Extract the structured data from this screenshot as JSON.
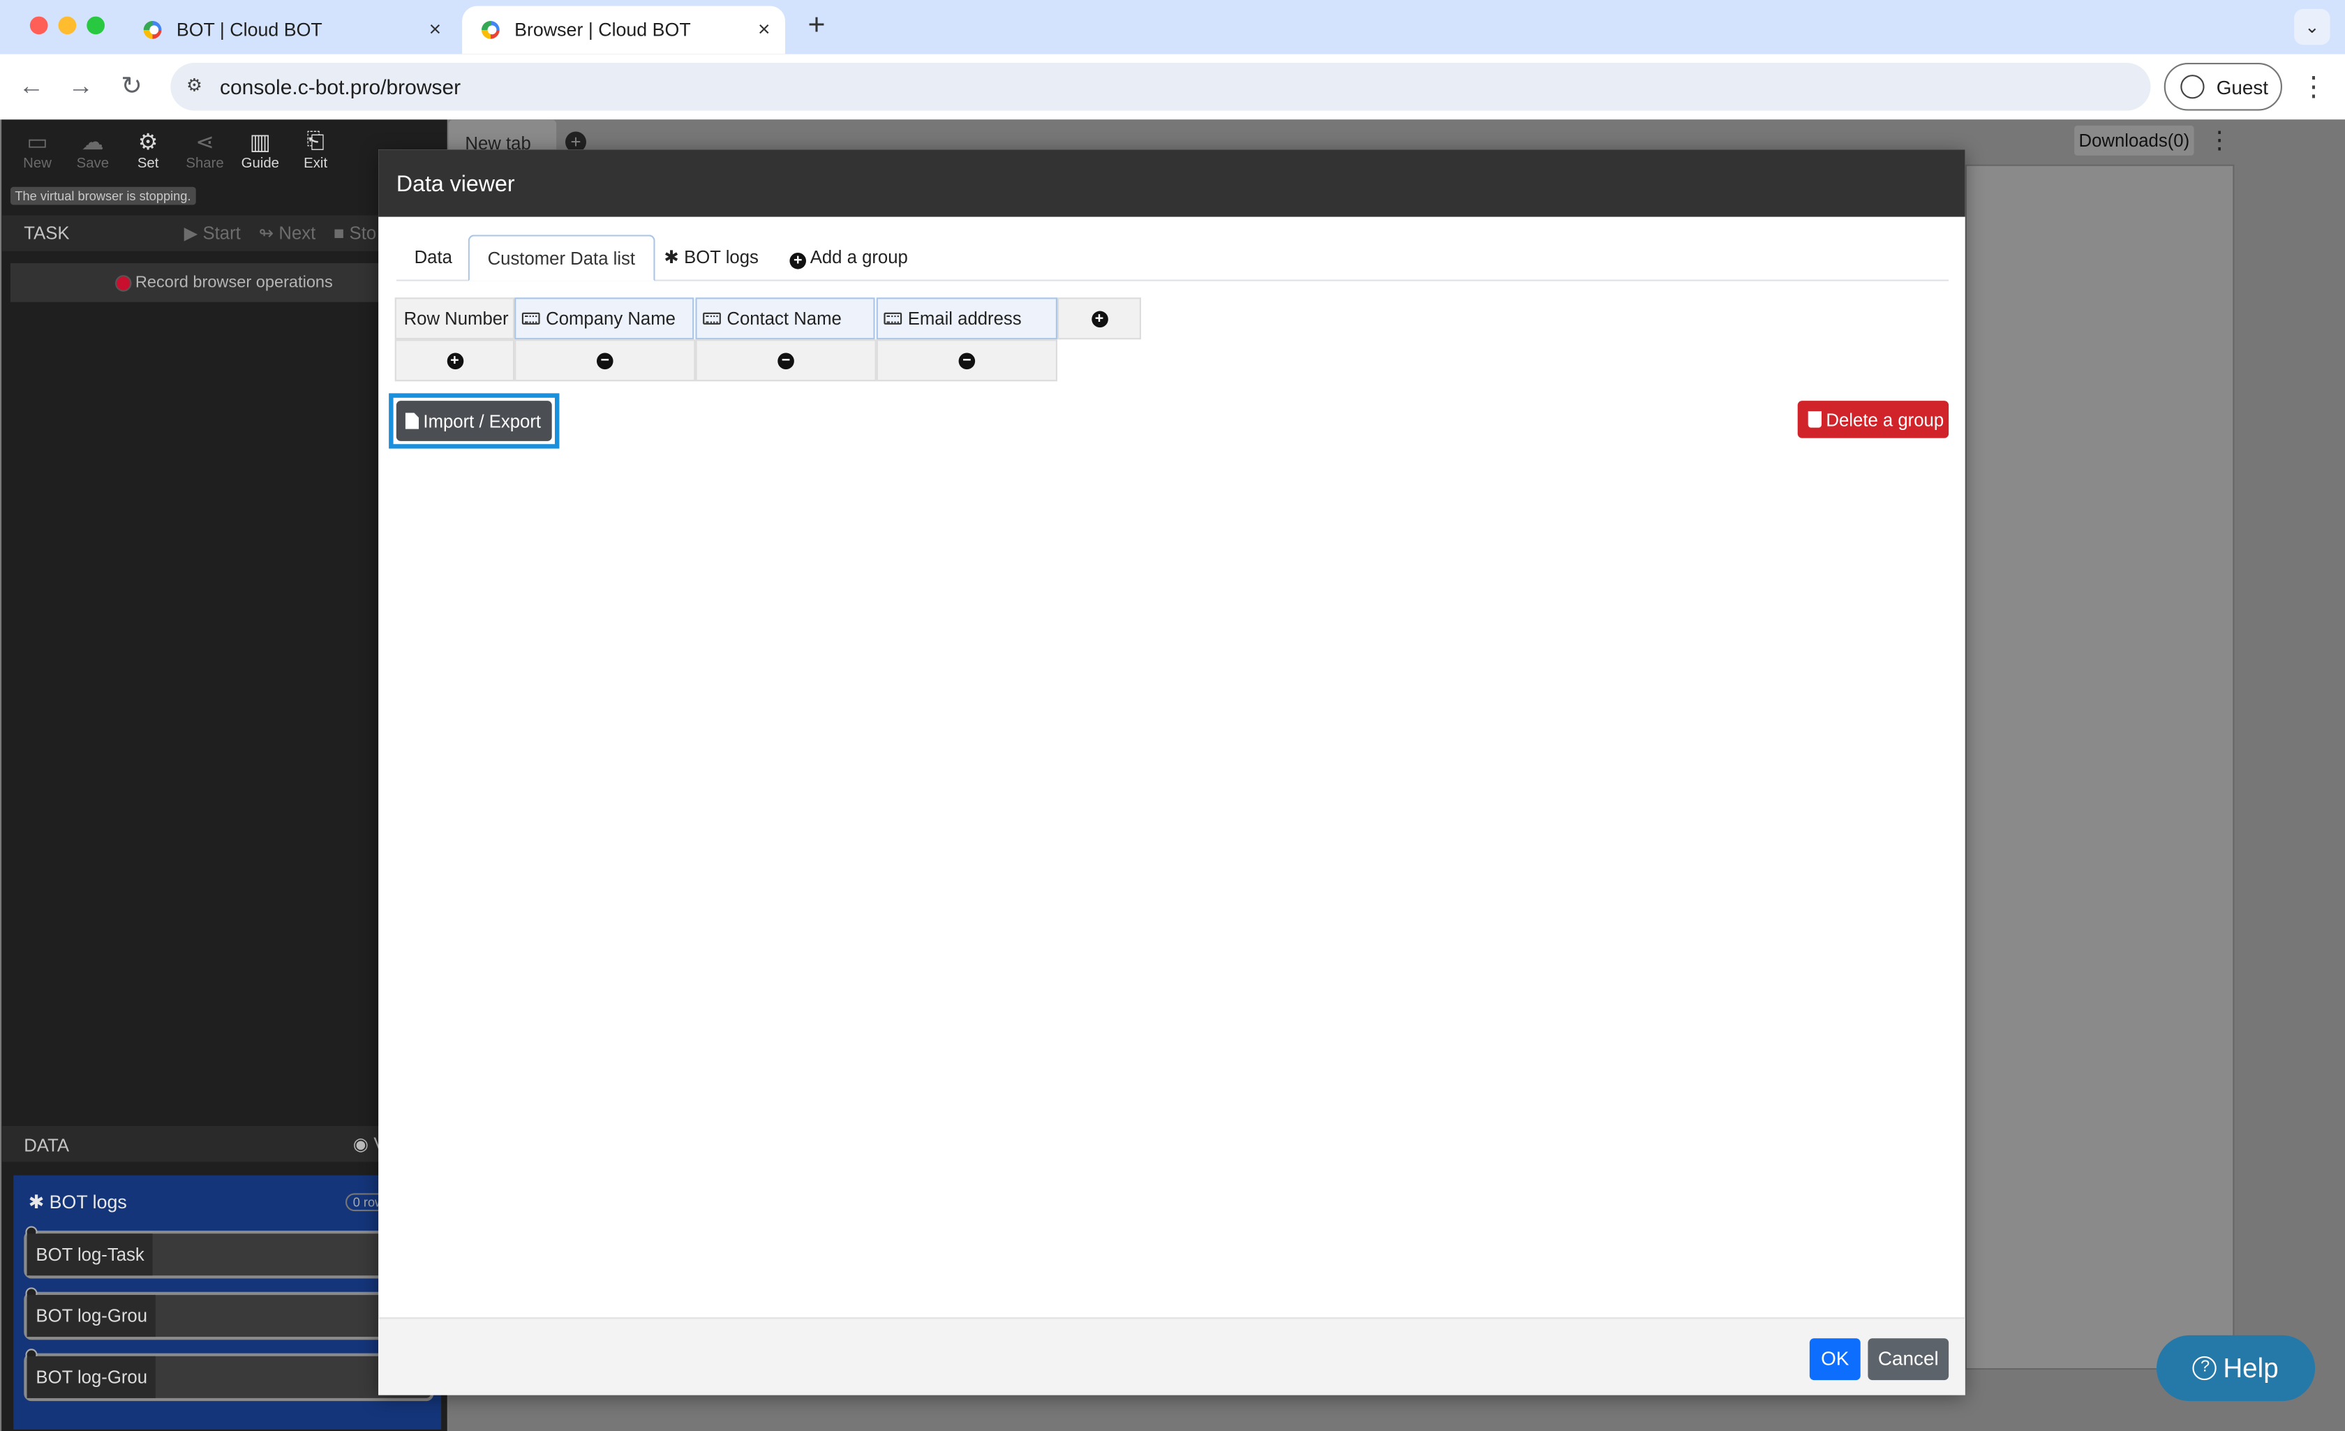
{
  "browser": {
    "tabs": [
      {
        "title": "BOT | Cloud BOT",
        "active": false
      },
      {
        "title": "Browser | Cloud BOT",
        "active": true
      }
    ],
    "close_glyph": "×",
    "newtab_glyph": "+",
    "url": "console.c-bot.pro/browser",
    "profile_label": "Guest"
  },
  "app": {
    "toolbar": [
      {
        "label": "New",
        "icon": "file-icon"
      },
      {
        "label": "Save",
        "icon": "cloud-upload-icon"
      },
      {
        "label": "Set",
        "icon": "gear-icon"
      },
      {
        "label": "Share",
        "icon": "share-icon"
      },
      {
        "label": "Guide",
        "icon": "book-icon"
      },
      {
        "label": "Exit",
        "icon": "exit-icon"
      }
    ],
    "status": "The virtual browser is stopping.",
    "task_label": "TASK",
    "task_controls": {
      "start": "Start",
      "next": "Next",
      "stop": "Sto"
    },
    "record_label": "Record browser operations",
    "data_label": "DATA",
    "data_view_label": "V",
    "bot_logs": {
      "title": "BOT logs",
      "rows": "0 row",
      "items": [
        "BOT log-Task",
        "BOT log-Grou",
        "BOT log-Grou"
      ]
    },
    "browser_tab": "New tab",
    "downloads": "Downloads(0)",
    "help": "Help"
  },
  "modal": {
    "title": "Data viewer",
    "tabs": [
      "Data",
      "Customer Data list",
      "BOT logs",
      "Add a group"
    ],
    "active_tab": 1,
    "grid": {
      "row_number_header": "Row Number",
      "columns": [
        "Company Name",
        "Contact Name",
        "Email address"
      ]
    },
    "import_export": "Import / Export",
    "delete_group": "Delete a group",
    "ok": "OK",
    "cancel": "Cancel"
  },
  "colors": {
    "tabstrip": "#d3e3fd",
    "modal_header": "#333333",
    "primary": "#0d6efd",
    "danger": "#d1232a",
    "highlight": "#1a8fdc",
    "help": "#2479a9"
  }
}
